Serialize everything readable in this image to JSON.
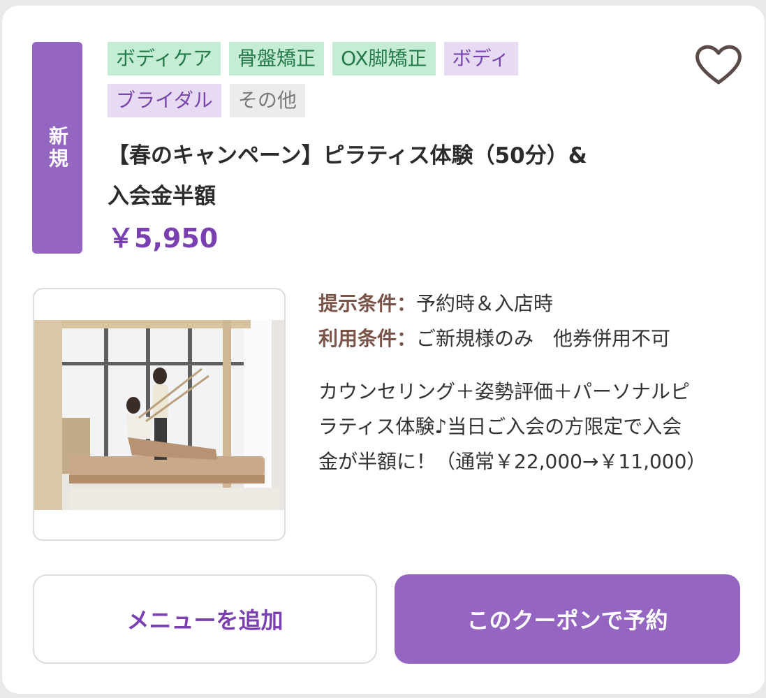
{
  "badge": {
    "label": "新規"
  },
  "tags": [
    [
      {
        "label": "ボディケア",
        "style": "green"
      },
      {
        "label": "骨盤矯正",
        "style": "green"
      },
      {
        "label": "OX脚矯正",
        "style": "green"
      },
      {
        "label": "ボディ",
        "style": "purple"
      }
    ],
    [
      {
        "label": "ブライダル",
        "style": "purple"
      },
      {
        "label": "その他",
        "style": "gray"
      }
    ]
  ],
  "favorite": {
    "icon": "heart-outline-icon"
  },
  "coupon": {
    "title_line1": "【春のキャンペーン】ピラティス体験（50分）&",
    "title_line2": "入会金半額",
    "price": "￥5,950",
    "photo": {
      "description": "pilates-studio-photo"
    },
    "conditions": [
      {
        "label": "提示条件",
        "value": "予約時＆入店時"
      },
      {
        "label": "利用条件",
        "value": "ご新規様のみ　他券併用不可"
      }
    ],
    "description_lines": [
      "カウンセリング＋姿勢評価＋パーソナルピ",
      "ラティス体験♪当日ご入会の方限定で入会",
      "金が半額に！（通常￥22,000→￥11,000）"
    ]
  },
  "buttons": {
    "add_menu": "メニューを追加",
    "book": "このクーポンで予約"
  },
  "colors": {
    "accent": "#9466c1",
    "price": "#7a3fb0",
    "tag_green_bg": "#c5ecd5",
    "tag_purple_bg": "#e7dbf3",
    "tag_gray_bg": "#ececec"
  }
}
